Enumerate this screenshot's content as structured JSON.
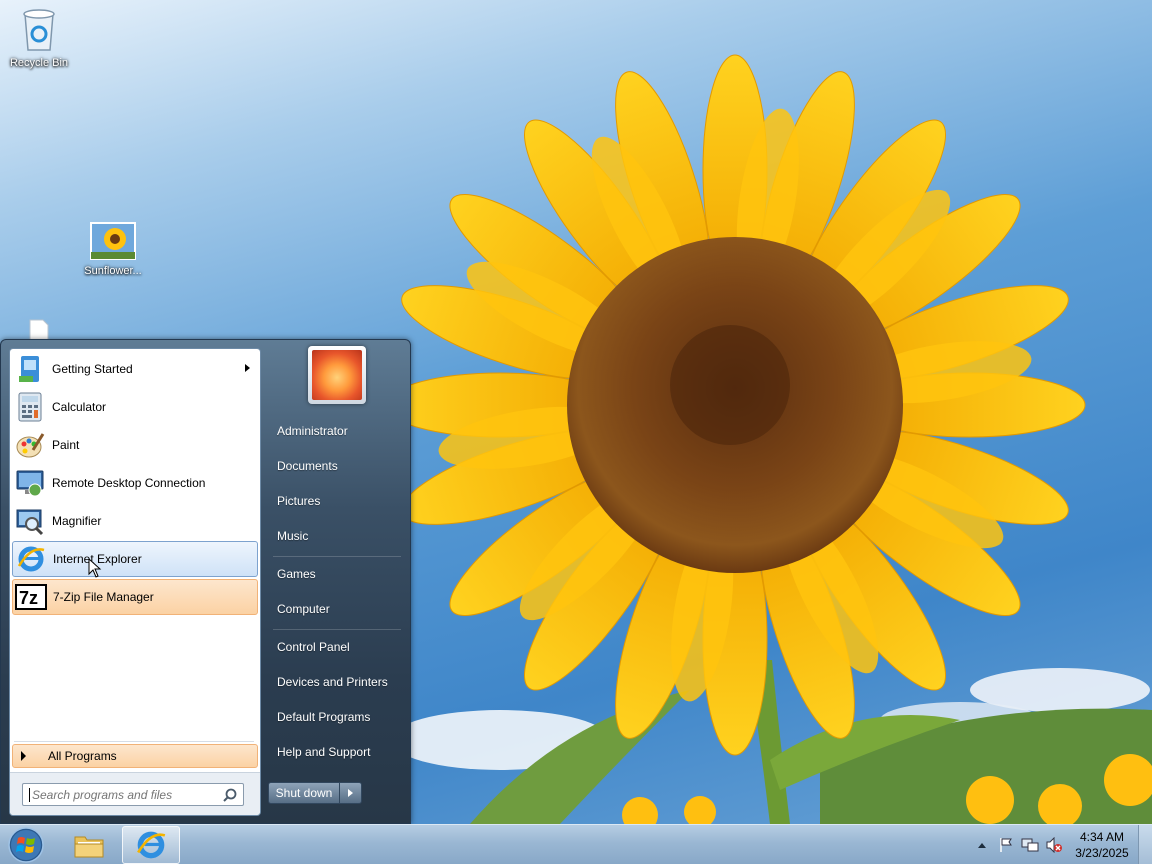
{
  "desktop": {
    "icons": [
      {
        "label": "Recycle Bin",
        "icon": "recycle-bin-icon"
      },
      {
        "label": "Sunflower...",
        "icon": "image-file-icon"
      },
      {
        "label": "",
        "icon": "document-file-icon"
      }
    ]
  },
  "start_menu": {
    "programs": [
      {
        "label": "Getting Started",
        "icon": "getting-started-icon",
        "has_submenu": true
      },
      {
        "label": "Calculator",
        "icon": "calculator-icon"
      },
      {
        "label": "Paint",
        "icon": "paint-icon"
      },
      {
        "label": "Remote Desktop Connection",
        "icon": "remote-desktop-icon"
      },
      {
        "label": "Magnifier",
        "icon": "magnifier-icon"
      },
      {
        "label": "Internet Explorer",
        "icon": "internet-explorer-icon",
        "state": "hover"
      },
      {
        "label": "7-Zip File Manager",
        "icon": "7zip-icon",
        "state": "new-install-highlight"
      }
    ],
    "all_programs_label": "All Programs",
    "search_placeholder": "Search programs and files",
    "right_pane": {
      "user": "Administrator",
      "items": [
        "Documents",
        "Pictures",
        "Music",
        "Games",
        "Computer",
        "Control Panel",
        "Devices and Printers",
        "Default Programs",
        "Help and Support"
      ]
    },
    "shutdown_label": "Shut down"
  },
  "taskbar": {
    "pinned": [
      {
        "name": "Windows Explorer",
        "icon": "folder-icon"
      },
      {
        "name": "Internet Explorer",
        "icon": "internet-explorer-icon",
        "active": true
      }
    ],
    "clock": {
      "time": "4:34 AM",
      "date": "3/23/2025"
    },
    "tray_icons": [
      "show-hidden-icons",
      "action-center-flag-icon",
      "network-icon",
      "volume-muted-icon"
    ]
  },
  "colors": {
    "start_menu_bg": "#2b3d50",
    "hover_blue": "#cfe2f7",
    "highlight_orange": "#fbd2a4",
    "taskbar": "#9ab7d3"
  }
}
